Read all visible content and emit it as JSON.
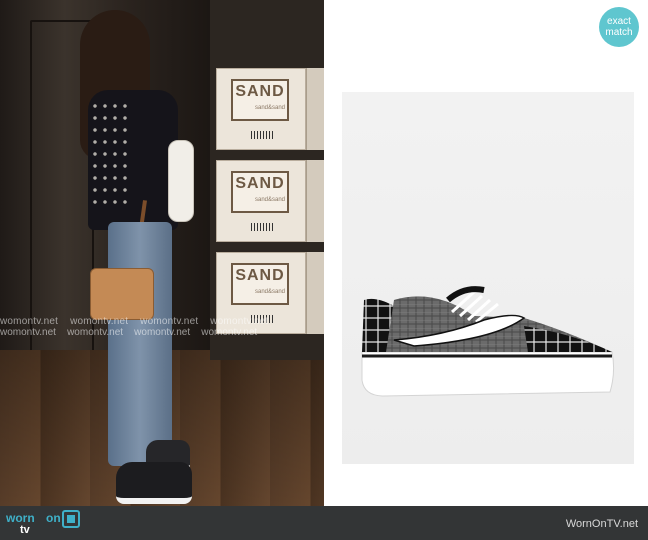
{
  "left_photo": {
    "box_label": "SAND",
    "box_sub": "sand&sand",
    "watermark": "womontv.net"
  },
  "right_panel": {
    "badge_line1": "exact",
    "badge_line2": "match"
  },
  "footer": {
    "logo_word1": "worn",
    "logo_word2": "on",
    "logo_word3": "tv",
    "site_text": "WornOnTV.net"
  },
  "colors": {
    "badge": "#5fc6cf",
    "footer_bg": "#333536",
    "logo_blue": "#3fb0c8"
  }
}
